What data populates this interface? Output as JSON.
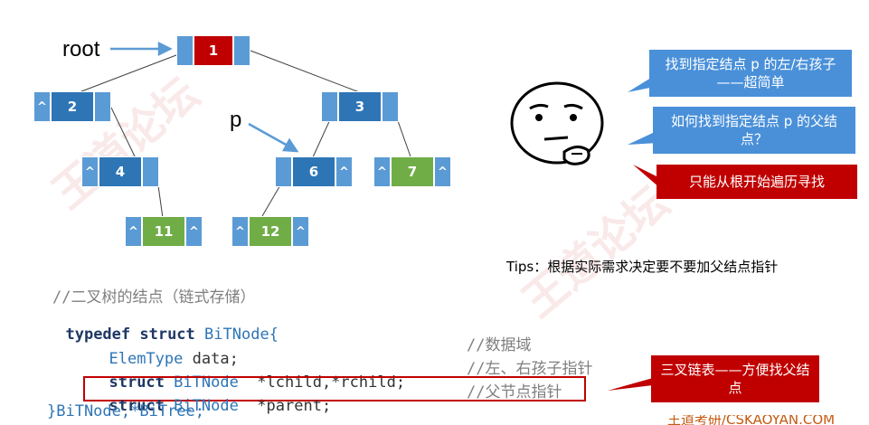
{
  "labels": {
    "root": "root",
    "p": "p"
  },
  "nodes": {
    "n1": {
      "value": "1"
    },
    "n2": {
      "left": "^",
      "value": "2"
    },
    "n3": {
      "value": "3"
    },
    "n4": {
      "left": "^",
      "value": "4"
    },
    "n6": {
      "value": "6",
      "right": "^"
    },
    "n7": {
      "left": "^",
      "value": "7",
      "right": "^"
    },
    "n11": {
      "left": "^",
      "value": "11",
      "right": "^"
    },
    "n12": {
      "left": "^",
      "value": "12",
      "right": "^"
    }
  },
  "bubbles": {
    "b1": "找到指定结点 p 的左/右孩子——超简单",
    "b2": "如何找到指定结点 p 的父结点？",
    "b3": "只能从根开始遍历寻找",
    "b4": "三叉链表——方便找父结点"
  },
  "tips": "Tips：根据实际需求决定要不要加父结点指针",
  "code": {
    "comment": "//二叉树的结点（链式存储）",
    "l1_kw": "typedef struct",
    "l1_name": "BiTNode{",
    "l2_type": "ElemType",
    "l2_field": "data;",
    "l2_comment": "//数据域",
    "l3_kw": "struct",
    "l3_type": "BiTNode",
    "l3_field": "*lchild,*rchild;",
    "l3_comment": "//左、右孩子指针",
    "l4_kw": "struct",
    "l4_type": "BiTNode",
    "l4_field": "*parent;",
    "l4_comment": "//父节点指针",
    "l5": "}BiTNode,*BiTree;"
  },
  "footer": "王道考研/CSKAOYAN.COM",
  "colors": {
    "red": "#c00000",
    "blue": "#4472c4",
    "green": "#70ad47",
    "bubble_blue": "#4a90d9"
  }
}
